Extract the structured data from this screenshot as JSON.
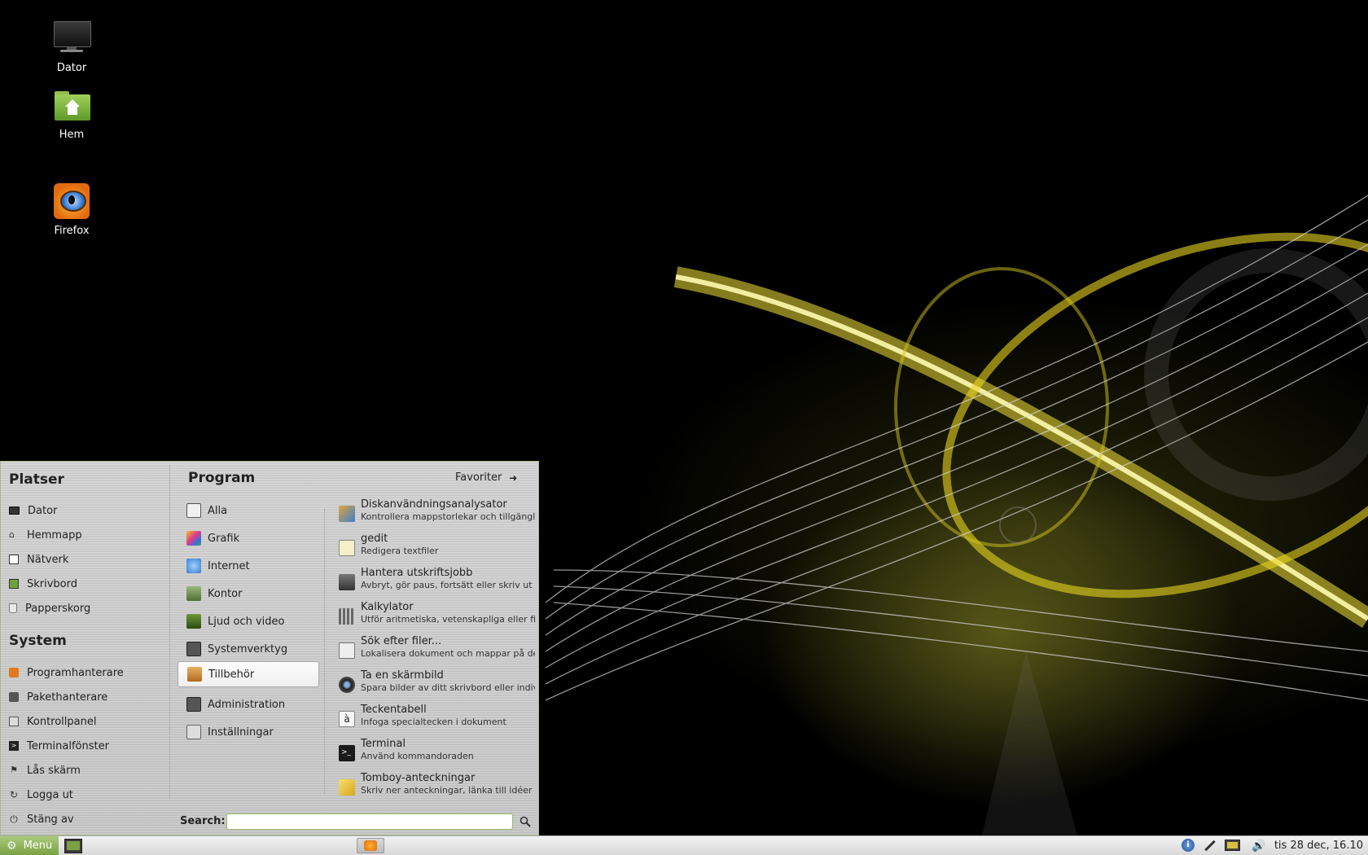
{
  "desktop": {
    "icons": [
      {
        "label": "Dator",
        "icon": "monitor-icon"
      },
      {
        "label": "Hem",
        "icon": "home-folder-icon"
      },
      {
        "label": "Firefox",
        "icon": "firefox-icon"
      }
    ]
  },
  "menu": {
    "places": {
      "title": "Platser",
      "items": [
        {
          "label": "Dator",
          "icon": "monitor-icon"
        },
        {
          "label": "Hemmapp",
          "icon": "home-icon"
        },
        {
          "label": "Nätverk",
          "icon": "network-icon"
        },
        {
          "label": "Skrivbord",
          "icon": "desktop-icon"
        },
        {
          "label": "Papperskorg",
          "icon": "trash-icon"
        }
      ]
    },
    "system": {
      "title": "System",
      "items": [
        {
          "label": "Programhanterare",
          "icon": "software-manager-icon"
        },
        {
          "label": "Pakethanterare",
          "icon": "package-manager-icon"
        },
        {
          "label": "Kontrollpanel",
          "icon": "control-panel-icon"
        },
        {
          "label": "Terminalfönster",
          "icon": "terminal-icon"
        },
        {
          "label": "Lås skärm",
          "icon": "lock-icon"
        },
        {
          "label": "Logga ut",
          "icon": "logout-icon"
        },
        {
          "label": "Stäng av",
          "icon": "power-icon"
        }
      ]
    },
    "program_title": "Program",
    "favorites_label": "Favoriter",
    "categories": [
      {
        "label": "Alla",
        "icon": "all-apps-icon",
        "color": "#ececec"
      },
      {
        "label": "Grafik",
        "icon": "graphics-icon",
        "color": "#d8428f"
      },
      {
        "label": "Internet",
        "icon": "internet-icon",
        "color": "#4a90d9"
      },
      {
        "label": "Kontor",
        "icon": "office-icon",
        "color": "#5b7f3a"
      },
      {
        "label": "Ljud och video",
        "icon": "multimedia-icon",
        "color": "#4a6b2a"
      },
      {
        "label": "Systemverktyg",
        "icon": "system-tools-icon",
        "color": "#555555"
      },
      {
        "label": "Tillbehör",
        "icon": "accessories-icon",
        "color": "#c98a3a",
        "selected": true
      },
      {
        "label": "Administration",
        "icon": "administration-icon",
        "color": "#555555"
      },
      {
        "label": "Inställningar",
        "icon": "settings-icon",
        "color": "#888888"
      }
    ],
    "apps": [
      {
        "name": "Diskanvändningsanalysator",
        "desc": "Kontrollera mappstorlekar och tillgänglig...",
        "icon": "disk-usage-icon",
        "color": "#e0a43a"
      },
      {
        "name": "gedit",
        "desc": "Redigera textfiler",
        "icon": "text-editor-icon",
        "color": "#f2e7a8"
      },
      {
        "name": "Hantera utskriftsjobb",
        "desc": "Avbryt, gör paus, fortsätt eller skriv ut jo...",
        "icon": "printer-icon",
        "color": "#555555"
      },
      {
        "name": "Kalkylator",
        "desc": "Utför aritmetiska, vetenskapliga eller fin...",
        "icon": "calculator-icon",
        "color": "#9a9a9a"
      },
      {
        "name": "Sök efter filer...",
        "desc": "Lokalisera dokument och mappar på den...",
        "icon": "search-files-icon",
        "color": "#dddddd"
      },
      {
        "name": "Ta en skärmbild",
        "desc": "Spara bilder av ditt skrivbord eller indivi...",
        "icon": "screenshot-icon",
        "color": "#444444"
      },
      {
        "name": "Teckentabell",
        "desc": "Infoga specialtecken i dokument",
        "icon": "character-map-icon",
        "color": "#f4f4f4"
      },
      {
        "name": "Terminal",
        "desc": "Använd kommandoraden",
        "icon": "terminal-icon",
        "color": "#2a2a2a"
      },
      {
        "name": "Tomboy-anteckningar",
        "desc": "Skriv ner anteckningar, länka till idéer o...",
        "icon": "notes-icon",
        "color": "#e8c83a"
      }
    ],
    "search_label": "Search:",
    "search_value": ""
  },
  "panel": {
    "menu_label": "Menu",
    "clock": "tis 28 dec, 16.10",
    "tray": [
      "shield-icon",
      "network-tool-icon",
      "display-icon",
      "volume-icon"
    ]
  }
}
